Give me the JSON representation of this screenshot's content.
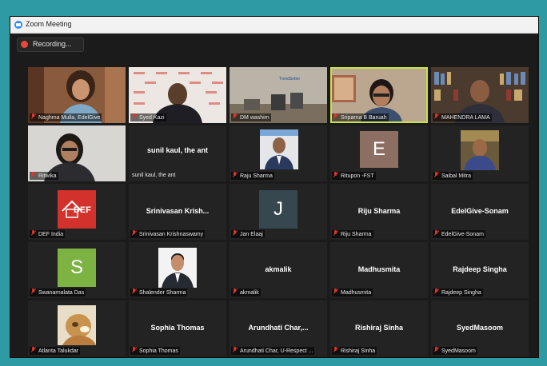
{
  "window": {
    "title": "Zoom Meeting"
  },
  "recording": {
    "label": "Recording..."
  },
  "colors": {
    "active_speaker": "#c9e24a",
    "muted_mic": "#e0342b",
    "letter_J": "#37474f",
    "letter_E": "#8d6e63",
    "letter_S": "#7cb342"
  },
  "participants": [
    {
      "label": "Naghma Mulla, EdelGive"
    },
    {
      "label": "Syed Kazi"
    },
    {
      "label": "DM washim",
      "wall_text": "TrendSetter"
    },
    {
      "label": "Sriparna B Baruah"
    },
    {
      "label": "MAHENDRA LAMA"
    },
    {
      "label": "Ritwika"
    },
    {
      "label": "sunil kaul, the ant",
      "display": "sunil kaul, the ant"
    },
    {
      "label": "Raju Sharma"
    },
    {
      "label": "Ritupon -FST",
      "avatar": "E"
    },
    {
      "label": "Saibal Mitra"
    },
    {
      "label": "DEF India",
      "logo_text": "DEF"
    },
    {
      "label": "Srinivasan Krishnaswamy",
      "display": "Srinivasan  Krish..."
    },
    {
      "label": "Jan Elaaj",
      "avatar": "J"
    },
    {
      "label": "Riju Sharma",
      "display": "Riju Sharma"
    },
    {
      "label": "EdelGive-Sonam",
      "display": "EdelGive-Sonam"
    },
    {
      "label": "Swanarnalata Das",
      "avatar": "S"
    },
    {
      "label": "Shalender Sharma"
    },
    {
      "label": "akmalik",
      "display": "akmalik"
    },
    {
      "label": "Madhusmita",
      "display": "Madhusmita"
    },
    {
      "label": "Rajdeep Singha",
      "display": "Rajdeep Singha"
    },
    {
      "label": "Atlanta Talukdar"
    },
    {
      "label": "Sophia Thomas",
      "display": "Sophia Thomas"
    },
    {
      "label": "Arundhati Char, U-Respect ...",
      "display": "Arundhati  Char,..."
    },
    {
      "label": "Rishiraj Sinha",
      "display": "Rishiraj Sinha"
    },
    {
      "label": "SyedMasoom",
      "display": "SyedMasoom"
    }
  ]
}
